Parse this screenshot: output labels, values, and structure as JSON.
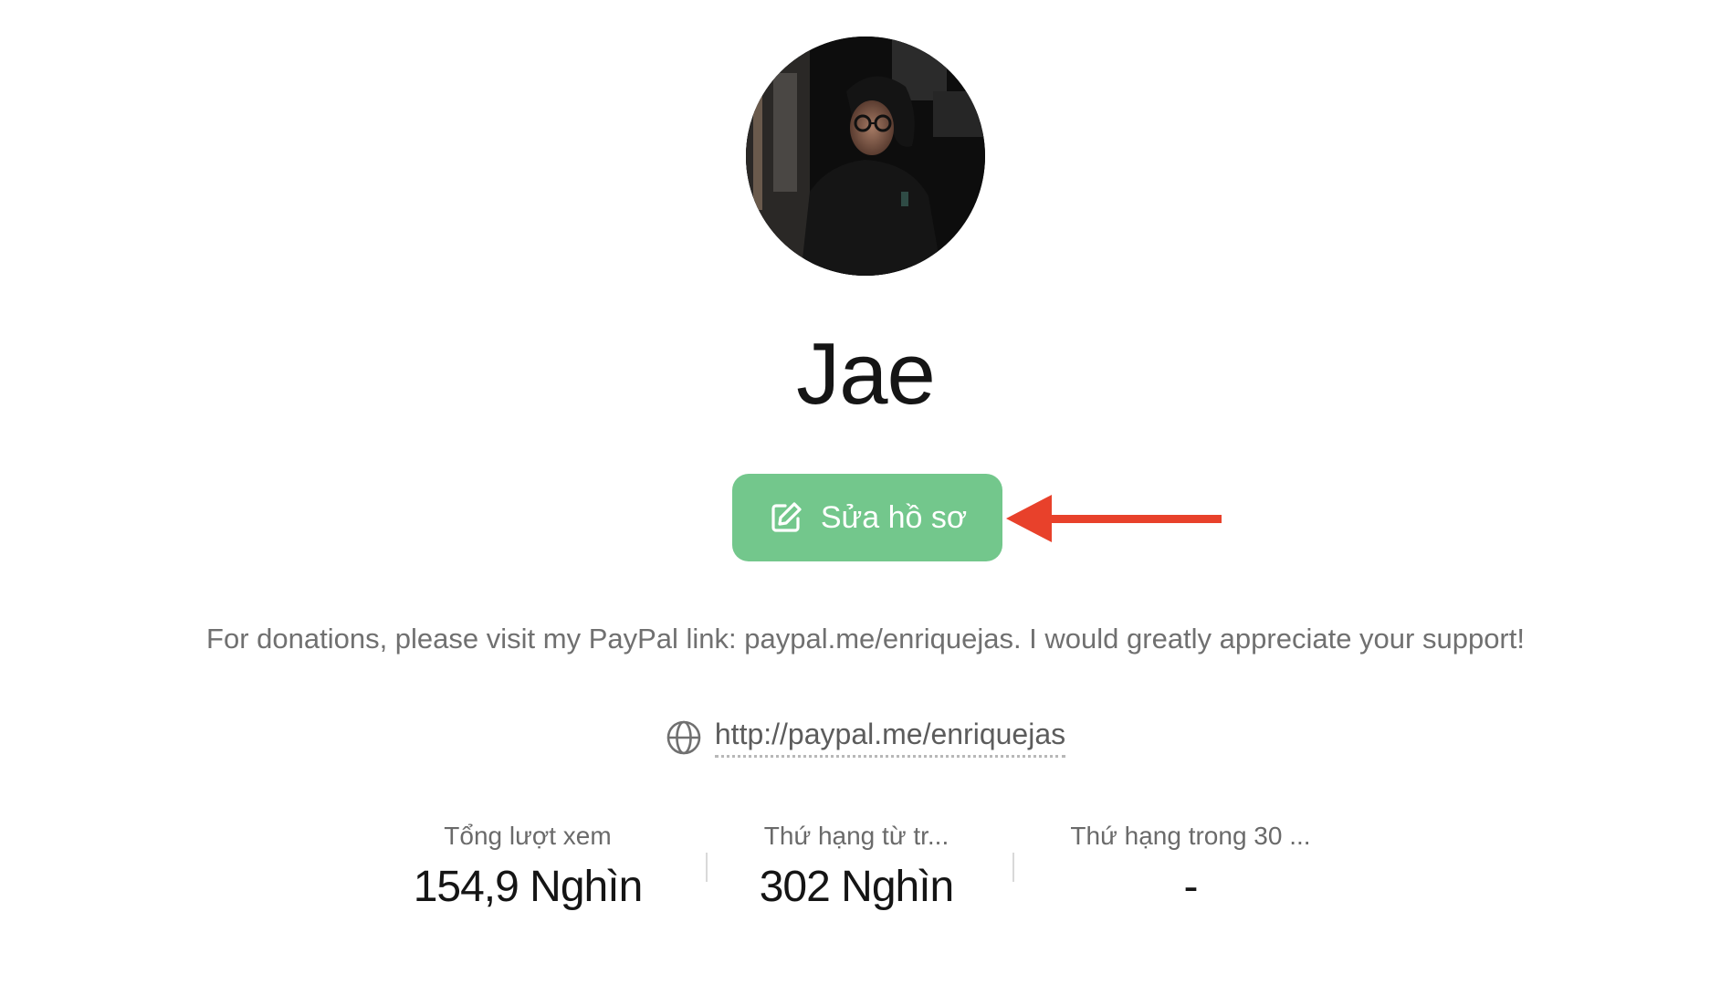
{
  "profile": {
    "name": "Jae",
    "edit_button_label": "Sửa hồ sơ",
    "bio": "For donations, please visit my PayPal link: paypal.me/enriquejas. I would greatly appreciate your support!",
    "website": "http://paypal.me/enriquejas"
  },
  "stats": [
    {
      "label": "Tổng lượt xem",
      "value": "154,9 Nghìn"
    },
    {
      "label": "Thứ hạng từ tr...",
      "value": "302 Nghìn"
    },
    {
      "label": "Thứ hạng trong 30 ...",
      "value": "-"
    }
  ],
  "colors": {
    "button_bg": "#73c78c",
    "annotation_arrow": "#e8412b"
  },
  "icons": {
    "edit": "edit-icon",
    "globe": "globe-icon",
    "arrow": "arrow-left-icon"
  }
}
